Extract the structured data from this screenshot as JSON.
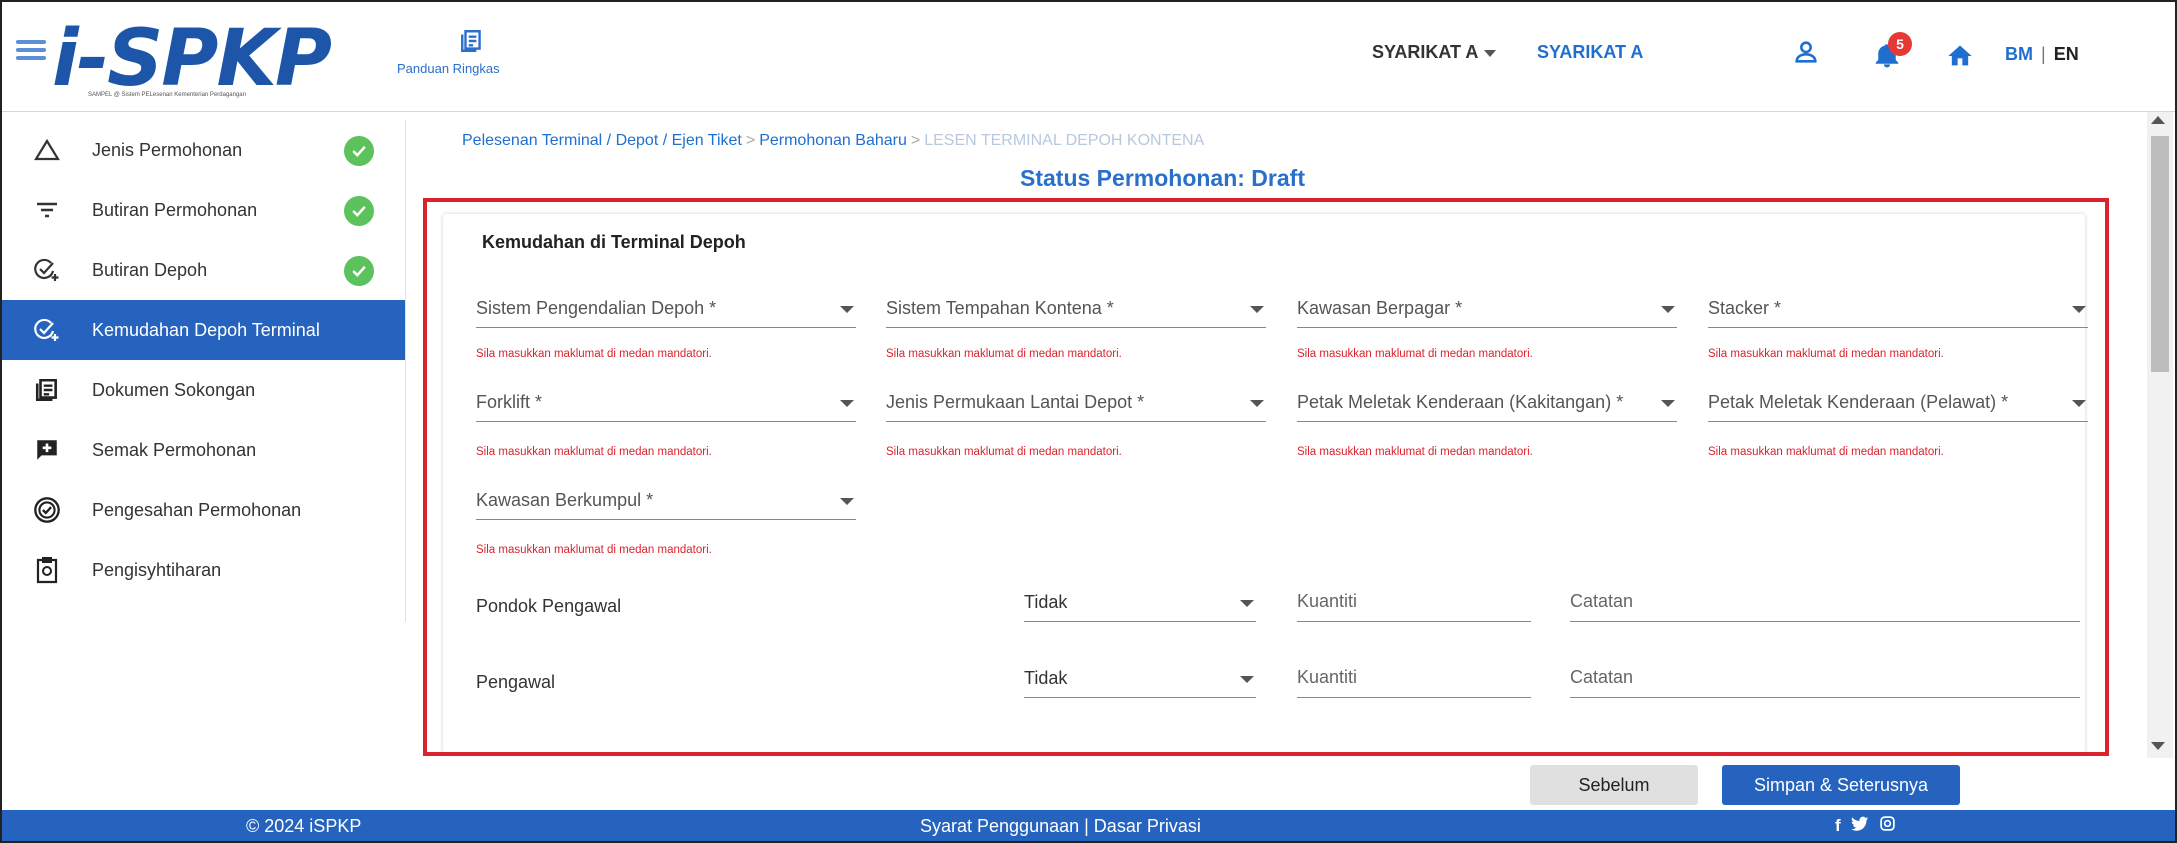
{
  "header": {
    "logo_text": "i-SPKP",
    "logo_subtitle": "SAMPEL @ Sistem PELesenan Kementerian Perdagangan",
    "guide_label": "Panduan Ringkas",
    "company_dropdown": "SYARIKAT A",
    "company_link": "SYARIKAT A",
    "notification_count": "5",
    "lang_bm": "BM",
    "lang_sep": "|",
    "lang_en": "EN"
  },
  "sidebar": {
    "items": [
      {
        "label": "Jenis Permohonan",
        "icon": "triangle-icon",
        "done": true
      },
      {
        "label": "Butiran Permohonan",
        "icon": "filter-icon",
        "done": true
      },
      {
        "label": "Butiran Depoh",
        "icon": "check-plus-icon",
        "done": true
      },
      {
        "label": "Kemudahan Depoh Terminal",
        "icon": "check-plus-icon",
        "done": false,
        "active": true
      },
      {
        "label": "Dokumen Sokongan",
        "icon": "document-icon",
        "done": false
      },
      {
        "label": "Semak Permohonan",
        "icon": "add-comment-icon",
        "done": false
      },
      {
        "label": "Pengesahan Permohonan",
        "icon": "verified-icon",
        "done": false
      },
      {
        "label": "Pengisyhtiharan",
        "icon": "clipboard-icon",
        "done": false
      }
    ]
  },
  "breadcrumb": {
    "part1": "Pelesenan Terminal / Depot / Ejen Tiket",
    "sep": ">",
    "part2": "Permohonan Baharu",
    "part3": "LESEN TERMINAL DEPOH KONTENA"
  },
  "status_title": "Status Permohonan: Draft",
  "form": {
    "title": "Kemudahan di Terminal Depoh",
    "error_text": "Sila masukkan maklumat di medan mandatori.",
    "fields": [
      "Sistem Pengendalian Depoh *",
      "Sistem Tempahan Kontena *",
      "Kawasan Berpagar *",
      "Stacker *",
      "Forklift *",
      "Jenis Permukaan Lantai Depot *",
      "Petak Meletak Kenderaan (Kakitangan) *",
      "Petak Meletak Kenderaan (Pelawat) *",
      "Kawasan Berkumpul *"
    ],
    "rows": [
      {
        "label": "Pondok Pengawal",
        "select": "Tidak",
        "qty_placeholder": "Kuantiti",
        "note_placeholder": "Catatan"
      },
      {
        "label": "Pengawal",
        "select": "Tidak",
        "qty_placeholder": "Kuantiti",
        "note_placeholder": "Catatan"
      }
    ]
  },
  "buttons": {
    "prev": "Sebelum",
    "next": "Simpan & Seterusnya"
  },
  "footer": {
    "copyright": "© 2024 iSPKP",
    "links": "Syarat Penggunaan | Dasar Privasi",
    "social": [
      "facebook-icon",
      "twitter-icon",
      "instagram-icon"
    ]
  },
  "colors": {
    "primary": "#2563be",
    "link": "#1f6fd1",
    "error": "#d9232e",
    "success": "#5cc25c"
  }
}
